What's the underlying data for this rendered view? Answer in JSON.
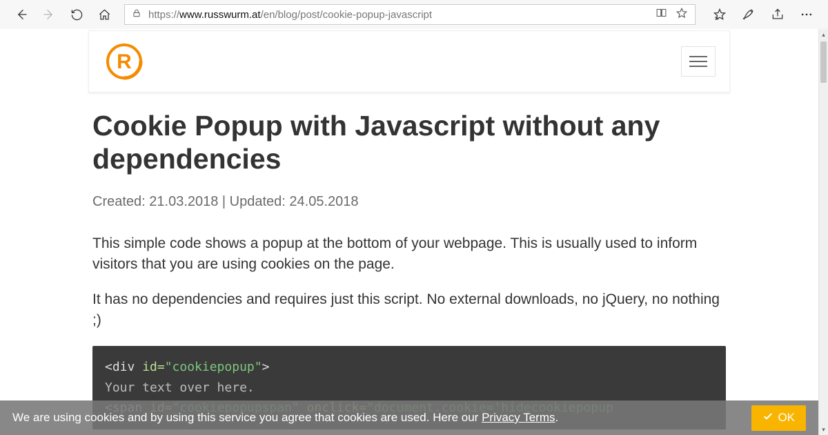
{
  "browser": {
    "url_prefix": "https://",
    "url_domain": "www.russwurm.at",
    "url_path": "/en/blog/post/cookie-popup-javascript"
  },
  "header": {
    "logo_letter": "R"
  },
  "article": {
    "title": "Cookie Popup with Javascript without any dependencies",
    "meta": "Created: 21.03.2018 | Updated: 24.05.2018",
    "p1": "This simple code shows a popup at the bottom of your webpage. This is usually used to inform visitors that you are using cookies on the page.",
    "p2": "It has no dependencies and requires just this script. No external downloads, no jQuery, no nothing ;)"
  },
  "code": {
    "l1_open": "<div ",
    "l1_attr": "id=",
    "l1_str": "\"cookiepopup\"",
    "l1_close": ">",
    "l2": "Your text over here.",
    "l3_open": "<span ",
    "l3_attr1": "id=",
    "l3_str1": "\"cookiepopupspan\"",
    "l3_attr2": " onclick=",
    "l3_str2": "\"document.cookie='hidecookiepopup"
  },
  "cookie": {
    "text": "We are using cookies and by using this service you agree that cookies are used. Here our ",
    "link": "Privacy Terms",
    "tail": ".",
    "ok": "OK"
  }
}
